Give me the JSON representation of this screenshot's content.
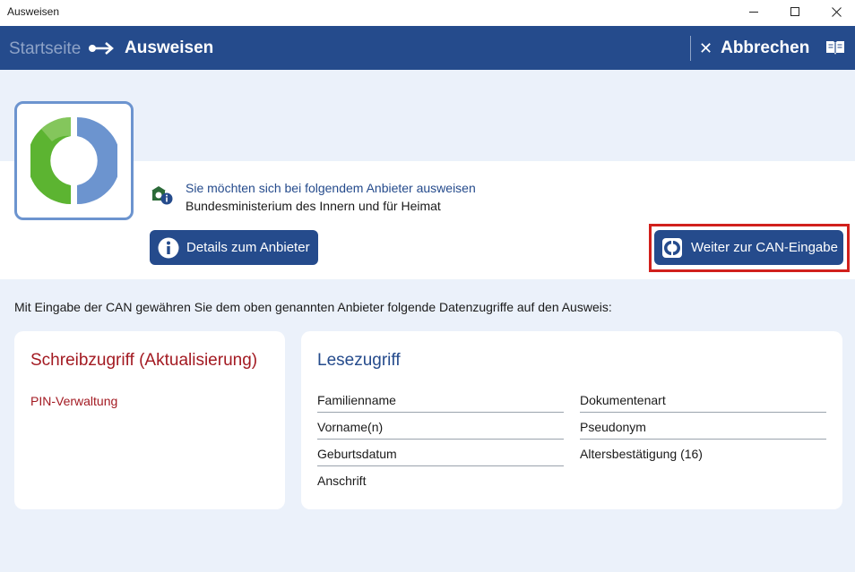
{
  "window": {
    "title": "Ausweisen",
    "controls": [
      "minimize-icon",
      "maximize-icon",
      "close-icon"
    ]
  },
  "nav": {
    "home": "Startseite",
    "current": "Ausweisen",
    "cancel_label": "Abbrechen",
    "help_icon": "book-icon"
  },
  "provider": {
    "label": "Sie möchten sich bei folgendem Anbieter ausweisen",
    "name": "Bundesministerium des Innern und für Heimat",
    "details_button": "Details zum Anbieter",
    "continue_button": "Weiter zur CAN-Eingabe"
  },
  "intro": "Mit Eingabe der CAN gewähren Sie dem oben genannten Anbieter folgende Datenzugriffe auf den Ausweis:",
  "write_access": {
    "title": "Schreibzugriff (Aktualisierung)",
    "items": [
      "PIN-Verwaltung"
    ]
  },
  "read_access": {
    "title": "Lesezugriff",
    "col1": [
      "Familienname",
      "Vorname(n)",
      "Geburtsdatum",
      "Anschrift"
    ],
    "col2": [
      "Dokumentenart",
      "Pseudonym",
      "Altersbestätigung (16)"
    ]
  },
  "colors": {
    "header": "#254b8c",
    "background": "#ebf1fa",
    "write_title": "#a31a22",
    "highlight": "#d1201c",
    "logo_green": "#5cb431",
    "logo_blue": "#6c94cf"
  }
}
